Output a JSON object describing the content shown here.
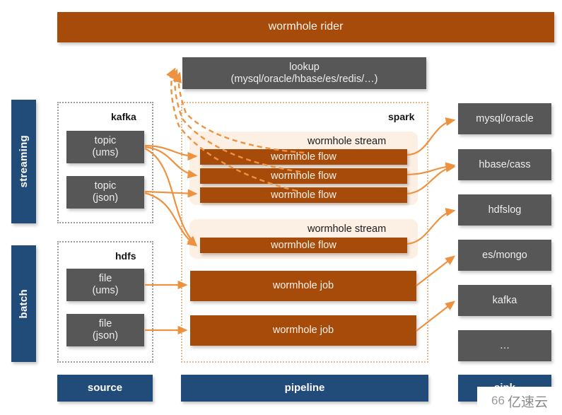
{
  "diagram": {
    "title": "wormhole rider",
    "top_bar": {
      "label": "wormhole rider"
    },
    "lookup": {
      "line1": "lookup",
      "line2": "(mysql/oracle/hbase/es/redis/…)"
    },
    "lanes": [
      {
        "id": "streaming",
        "label": "streaming"
      },
      {
        "id": "batch",
        "label": "batch"
      }
    ],
    "source_groups": [
      {
        "id": "kafka",
        "label": "kafka",
        "nodes": [
          {
            "line1": "topic",
            "line2": "(ums)"
          },
          {
            "line1": "topic",
            "line2": "(json)"
          }
        ]
      },
      {
        "id": "hdfs",
        "label": "hdfs",
        "nodes": [
          {
            "line1": "file",
            "line2": "(ums)"
          },
          {
            "line1": "file",
            "line2": "(json)"
          }
        ]
      }
    ],
    "pipeline": {
      "label": "spark",
      "streams": [
        {
          "label": "wormhole stream",
          "flows": [
            {
              "label": "wormhole flow"
            },
            {
              "label": "wormhole flow"
            },
            {
              "label": "wormhole flow"
            }
          ]
        },
        {
          "label": "wormhole stream",
          "flows": [
            {
              "label": "wormhole flow"
            }
          ]
        }
      ],
      "jobs": [
        {
          "label": "wormhole job"
        },
        {
          "label": "wormhole job"
        }
      ]
    },
    "sinks": [
      {
        "label": "mysql/oracle"
      },
      {
        "label": "hbase/cass"
      },
      {
        "label": "hdfslog"
      },
      {
        "label": "es/mongo"
      },
      {
        "label": "kafka"
      },
      {
        "label": "…"
      }
    ],
    "footer": [
      {
        "id": "source",
        "label": "source"
      },
      {
        "id": "pipeline",
        "label": "pipeline"
      },
      {
        "id": "sink",
        "label": "sink"
      }
    ],
    "watermark": {
      "logo": "66",
      "text": "亿速云"
    },
    "colors": {
      "brown": "#a74b0b",
      "grey": "#575757",
      "blue": "#214b78",
      "cream": "#fcefe4",
      "arrow": "#ed9240",
      "dotted_grey": "#9d9d9d",
      "dotted_orange": "#e8b98d"
    }
  }
}
